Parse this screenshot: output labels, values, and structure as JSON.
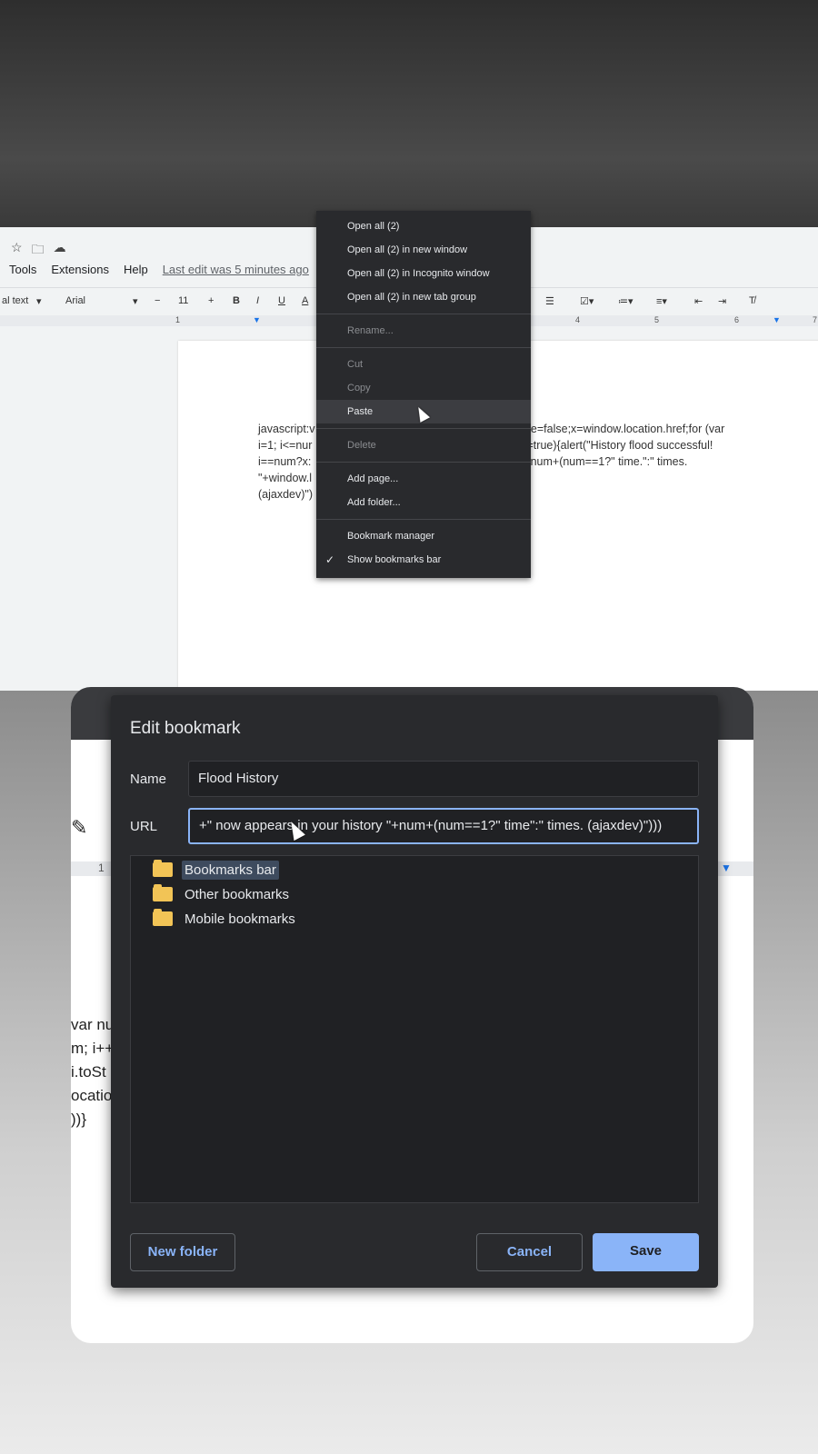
{
  "docs": {
    "icons": [
      "star-icon",
      "move-to-folder-icon",
      "cloud-status-icon"
    ],
    "menu": [
      "Tools",
      "Extensions",
      "Help"
    ],
    "last_edit": "Last edit was 5 minutes ago",
    "toolbar": {
      "style": "al text",
      "font": "Arial",
      "minus": "−",
      "size": "11",
      "plus": "+",
      "bold": "B",
      "italic": "I",
      "underline": "U",
      "color": "A"
    },
    "ruler": [
      "1",
      "4",
      "5",
      "6",
      "7"
    ],
    "code_left": [
      "javascript:v",
      "i=1; i<=nur",
      "i==num?x:",
      "\"+window.l",
      "(ajaxdev)\")"
    ],
    "code_right": [
      "\");done=false;x=window.location.href;for (var",
      "",
      "ne===true){alert(\"History flood successful!",
      "ory \"+num+(num==1?\" time.\":\" times.",
      ""
    ]
  },
  "context_menu": {
    "items": [
      {
        "label": "Open all (2)",
        "state": "enabled"
      },
      {
        "label": "Open all (2) in new window",
        "state": "enabled"
      },
      {
        "label": "Open all (2) in Incognito window",
        "state": "enabled"
      },
      {
        "label": "Open all (2) in new tab group",
        "state": "enabled"
      },
      {
        "label": "Rename...",
        "state": "disabled"
      },
      {
        "label": "Cut",
        "state": "disabled"
      },
      {
        "label": "Copy",
        "state": "disabled"
      },
      {
        "label": "Paste",
        "state": "hover"
      },
      {
        "label": "Delete",
        "state": "disabled"
      },
      {
        "label": "Add page...",
        "state": "enabled"
      },
      {
        "label": "Add folder...",
        "state": "enabled"
      },
      {
        "label": "Bookmark manager",
        "state": "enabled"
      },
      {
        "label": "Show bookmarks bar",
        "state": "checked"
      }
    ]
  },
  "background_doc": {
    "ruler_num": "1",
    "code": [
      "var nu",
      "m; i++",
      "i.toSt",
      "ocatio",
      "))}"
    ]
  },
  "dialog": {
    "title": "Edit bookmark",
    "name_label": "Name",
    "name_value": "Flood History",
    "url_label": "URL",
    "url_value": "+\" now appears in your history \"+num+(num==1?\" time\":\" times. (ajaxdev)\")))",
    "folders": [
      "Bookmarks bar",
      "Other bookmarks",
      "Mobile bookmarks"
    ],
    "selected_folder": "Bookmarks bar",
    "new_folder": "New folder",
    "cancel": "Cancel",
    "save": "Save"
  },
  "colors": {
    "accent": "#8ab4f8",
    "dialog_bg": "#292a2d",
    "folder": "#f2c456"
  }
}
